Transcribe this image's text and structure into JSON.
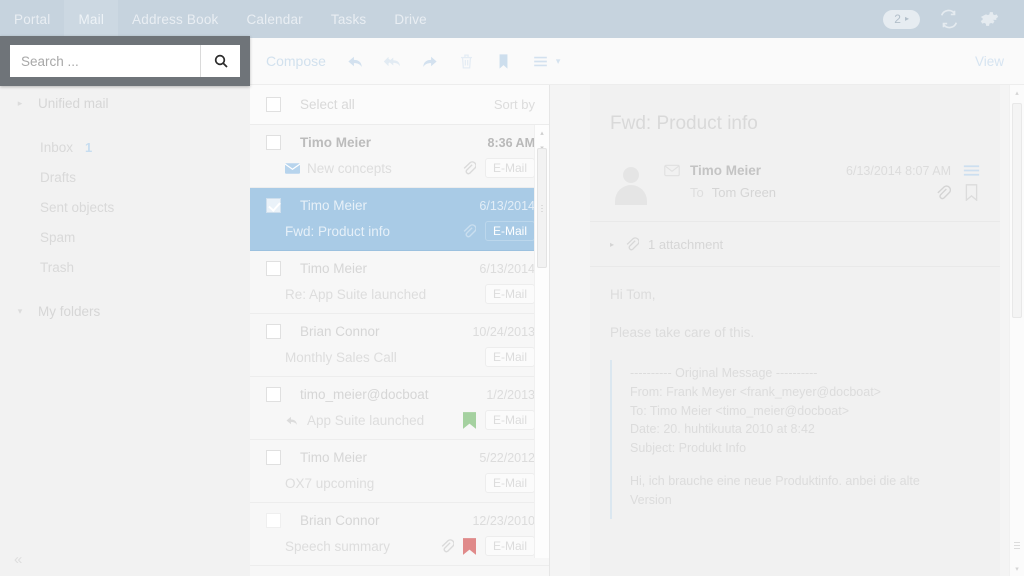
{
  "topbar": {
    "tabs": [
      {
        "label": "Portal",
        "active": false
      },
      {
        "label": "Mail",
        "active": true
      },
      {
        "label": "Address Book",
        "active": false
      },
      {
        "label": "Calendar",
        "active": false
      },
      {
        "label": "Tasks",
        "active": false
      },
      {
        "label": "Drive",
        "active": false
      }
    ],
    "notification_badge": "2",
    "badge_carat": "▸",
    "refresh_icon": "refresh-icon",
    "settings_icon": "gear-icon",
    "bg_color": "#c6d3de"
  },
  "search": {
    "placeholder": "Search ...",
    "value": "",
    "button_icon": "search-icon"
  },
  "sidebar": {
    "items": [
      {
        "label": "Unified mail",
        "twisty": "▸",
        "count": "",
        "group": true
      },
      {
        "label": "Inbox",
        "twisty": "",
        "count": "1",
        "group": false
      },
      {
        "label": "Drafts",
        "twisty": "",
        "count": "",
        "group": false
      },
      {
        "label": "Sent objects",
        "twisty": "",
        "count": "",
        "group": false
      },
      {
        "label": "Spam",
        "twisty": "",
        "count": "",
        "group": false
      },
      {
        "label": "Trash",
        "twisty": "",
        "count": "",
        "group": false
      },
      {
        "label": "My folders",
        "twisty": "▾",
        "count": "",
        "group": true
      }
    ],
    "collapse_label": "«",
    "count_color": "#9cc0e0"
  },
  "mailbar": {
    "compose_label": "Compose",
    "icons": [
      "reply-icon",
      "reply-all-icon",
      "forward-icon",
      "delete-icon",
      "flag-icon",
      "list-menu-icon"
    ],
    "dropdown_carat": "▾",
    "view_label": "View"
  },
  "list": {
    "select_all_label": "Select all",
    "sort_by_label": "Sort by",
    "rows": [
      {
        "from": "Timo Meier",
        "date": "8:36 AM",
        "subject": "New concepts",
        "tag": "E-Mail",
        "unread": true,
        "selected": false,
        "checked": false,
        "status_icon": "unread-envelope-icon",
        "has_attachment": true,
        "flag_color": ""
      },
      {
        "from": "Timo Meier",
        "date": "6/13/2014",
        "subject": "Fwd: Product info",
        "tag": "E-Mail",
        "unread": false,
        "selected": true,
        "checked": true,
        "status_icon": "",
        "has_attachment": true,
        "flag_color": ""
      },
      {
        "from": "Timo Meier",
        "date": "6/13/2014",
        "subject": "Re: App Suite launched",
        "tag": "E-Mail",
        "unread": false,
        "selected": false,
        "checked": false,
        "status_icon": "",
        "has_attachment": false,
        "flag_color": ""
      },
      {
        "from": "Brian Connor",
        "date": "10/24/2013",
        "subject": "Monthly Sales Call",
        "tag": "E-Mail",
        "unread": false,
        "selected": false,
        "checked": false,
        "status_icon": "",
        "has_attachment": false,
        "flag_color": ""
      },
      {
        "from": "timo_meier@docboat",
        "date": "1/2/2013",
        "subject": "App Suite launched",
        "tag": "E-Mail",
        "unread": false,
        "selected": false,
        "checked": false,
        "status_icon": "replied-arrow-icon",
        "has_attachment": false,
        "flag_color": "#a5d1a0"
      },
      {
        "from": "Timo Meier",
        "date": "5/22/2012",
        "subject": "OX7 upcoming",
        "tag": "E-Mail",
        "unread": false,
        "selected": false,
        "checked": false,
        "status_icon": "",
        "has_attachment": false,
        "flag_color": ""
      },
      {
        "from": "Brian Connor",
        "date": "12/23/2010",
        "subject": "Speech summary",
        "tag": "E-Mail",
        "unread": false,
        "selected": false,
        "checked": false,
        "status_icon": "",
        "has_attachment": true,
        "flag_color": "#e08a8a"
      }
    ],
    "selected_row_color": "#a9cbe6",
    "scroll_up": "▴",
    "scroll_down": "▾"
  },
  "detail": {
    "subject": "Fwd: Product info",
    "sender": "Timo Meier",
    "datetime": "6/13/2014 8:07 AM",
    "to_label": "To",
    "to_value": "Tom Green",
    "envelope_icon": "envelope-icon",
    "menu_icon": "list-menu-icon",
    "attachment_icon": "paperclip-icon",
    "bookmark_icon": "bookmark-icon",
    "avatar_icon": "avatar-placeholder-icon",
    "attachments": {
      "twisty": "▸",
      "icon": "paperclip-icon",
      "label": "1 attachment"
    },
    "body": {
      "greeting": "Hi Tom,",
      "line": "Please take care of this.",
      "quote_lines": [
        "---------- Original Message ----------",
        "From: Frank Meyer <frank_meyer@docboat>",
        "To: Timo Meier <timo_meier@docboat>",
        "Date: 20. huhtikuuta 2010 at 8:42",
        "Subject: Produkt Info"
      ],
      "quote_body": "Hi, ich brauche eine neue Produktinfo. anbei die alte\nVersion"
    },
    "scroll_up": "▴",
    "scroll_down": "▾"
  }
}
